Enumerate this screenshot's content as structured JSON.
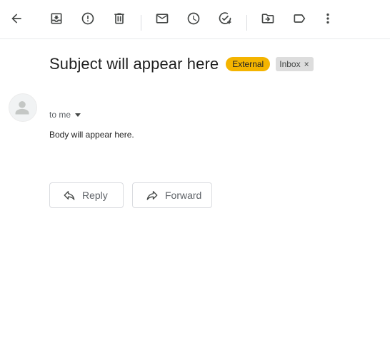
{
  "toolbar": {
    "buttons": [
      {
        "name": "back-icon",
        "label": "Back"
      },
      {
        "name": "archive-icon",
        "label": "Archive"
      },
      {
        "name": "report-spam-icon",
        "label": "Report spam"
      },
      {
        "name": "delete-icon",
        "label": "Delete"
      },
      {
        "name": "mark-unread-icon",
        "label": "Mark as unread"
      },
      {
        "name": "snooze-icon",
        "label": "Snooze"
      },
      {
        "name": "add-to-tasks-icon",
        "label": "Add to Tasks"
      },
      {
        "name": "move-to-icon",
        "label": "Move to"
      },
      {
        "name": "label-icon",
        "label": "Labels"
      },
      {
        "name": "more-icon",
        "label": "More"
      }
    ]
  },
  "message": {
    "subject": "Subject will appear here",
    "labels": {
      "external": "External",
      "inbox": "Inbox",
      "remove_glyph": "×"
    },
    "recipient": "to me",
    "body": "Body will appear here."
  },
  "actions": {
    "reply_label": "Reply",
    "forward_label": "Forward"
  },
  "colors": {
    "external_chip": "#f4b400",
    "inbox_chip": "#dddddd",
    "icon": "#444746"
  }
}
